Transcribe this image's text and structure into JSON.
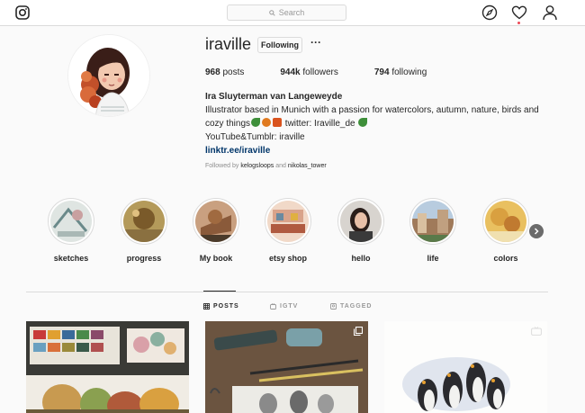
{
  "nav": {
    "search_placeholder": "Search",
    "icons": [
      "instagram-logo-icon",
      "search-icon",
      "compass-icon",
      "heart-icon",
      "person-icon"
    ]
  },
  "profile": {
    "username": "iraville",
    "follow_button": "Following",
    "more_button": "···",
    "stats": {
      "posts_count": "968",
      "posts_label": "posts",
      "followers_count": "944k",
      "followers_label": "followers",
      "following_count": "794",
      "following_label": "following"
    },
    "full_name": "Ira Sluyterman van Langeweyde",
    "bio_line1": "Illustrator based in Munich with a passion for watercolors, autumn, nature, birds and",
    "bio_line2a": "cozy things",
    "bio_line2b": " twitter: Iraville_de ",
    "bio_line3": "YouTube&Tumblr: iraville",
    "link": "linktr.ee/iraville",
    "followed_by_prefix": "Followed by",
    "followed_by_user1": "kelogsloops",
    "followed_by_and": "and",
    "followed_by_user2": "nikolas_tower"
  },
  "highlights": [
    {
      "label": "sketches",
      "color": "#c9d3cf"
    },
    {
      "label": "progress",
      "color": "#b49a5a"
    },
    {
      "label": "My book",
      "color": "#8a5a3a"
    },
    {
      "label": "etsy shop",
      "color": "#d9a38a"
    },
    {
      "label": "hello",
      "color": "#3a3a3a"
    },
    {
      "label": "life",
      "color": "#8aa0b8"
    },
    {
      "label": "colors",
      "color": "#d9a040"
    }
  ],
  "tabs": {
    "posts": "POSTS",
    "igtv": "IGTV",
    "tagged": "TAGGED"
  },
  "posts": [
    {
      "kind": "image",
      "badge": "none"
    },
    {
      "kind": "carousel",
      "badge": "multiple-icon"
    },
    {
      "kind": "video",
      "badge": "igtv-icon"
    }
  ],
  "colors": {
    "link": "#003569",
    "border": "#dbdbdb",
    "notification": "#ed4956",
    "leaf_green": "#3e8f3a",
    "leaf_orange": "#d96a1e"
  }
}
